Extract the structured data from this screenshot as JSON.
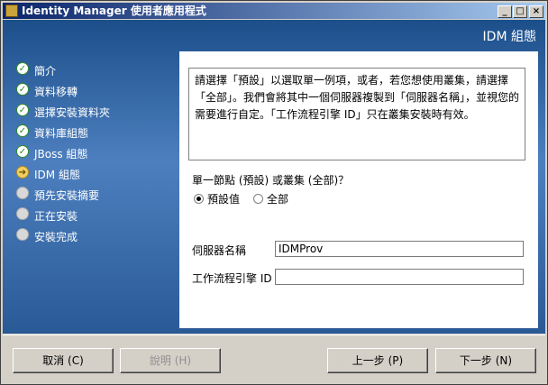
{
  "window": {
    "title": "Identity Manager 使用者應用程式"
  },
  "controls": {
    "minimize": "_",
    "maximize": "□",
    "close": "×"
  },
  "heading": "IDM 組態",
  "steps": [
    {
      "label": "簡介",
      "state": "done"
    },
    {
      "label": "資料移轉",
      "state": "done"
    },
    {
      "label": "選擇安裝資料夾",
      "state": "done"
    },
    {
      "label": "資料庫組態",
      "state": "done"
    },
    {
      "label": "JBoss 組態",
      "state": "done"
    },
    {
      "label": "IDM 組態",
      "state": "current"
    },
    {
      "label": "預先安裝摘要",
      "state": "pending"
    },
    {
      "label": "正在安裝",
      "state": "pending"
    },
    {
      "label": "安裝完成",
      "state": "pending"
    }
  ],
  "panel": {
    "description": "請選擇「預設」以選取單一例項，或者，若您想使用叢集，請選擇「全部」。我們會將其中一個伺服器複製到「伺服器名稱」，並視您的需要進行自定。「工作流程引擎 ID」只在叢集安裝時有效。",
    "question": "單一節點 (預設) 或叢集 (全部)？",
    "radio_default": "預設值",
    "radio_all": "全部",
    "server_name_label": "伺服器名稱",
    "server_name_value": "IDMProv",
    "engine_id_label": "工作流程引擎 ID",
    "engine_id_value": ""
  },
  "buttons": {
    "cancel": "取消 (C)",
    "help": "說明 (H)",
    "previous": "上一步 (P)",
    "next": "下一步 (N)"
  }
}
